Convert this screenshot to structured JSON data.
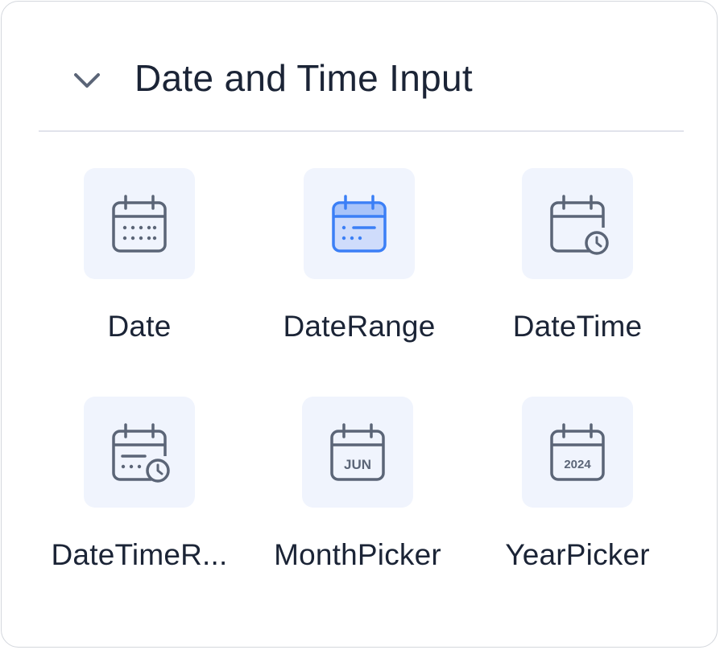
{
  "section": {
    "title": "Date and Time Input",
    "toggle_icon": "chevron-down-icon"
  },
  "components": [
    {
      "label": "Date",
      "icon": "calendar-icon"
    },
    {
      "label": "DateRange",
      "icon": "calendar-range-icon",
      "accent": "#3b7ff6"
    },
    {
      "label": "DateTime",
      "icon": "calendar-clock-icon"
    },
    {
      "label": "DateTimeR...",
      "icon": "calendar-range-clock-icon"
    },
    {
      "label": "MonthPicker",
      "icon": "month-calendar-icon",
      "icon_text": "JUN"
    },
    {
      "label": "YearPicker",
      "icon": "year-calendar-icon",
      "icon_text": "2024"
    }
  ],
  "colors": {
    "icon_default": "#5b6577",
    "icon_selected": "#3b7ff6",
    "tile_background": "#f0f4fd",
    "text": "#1b2436"
  }
}
